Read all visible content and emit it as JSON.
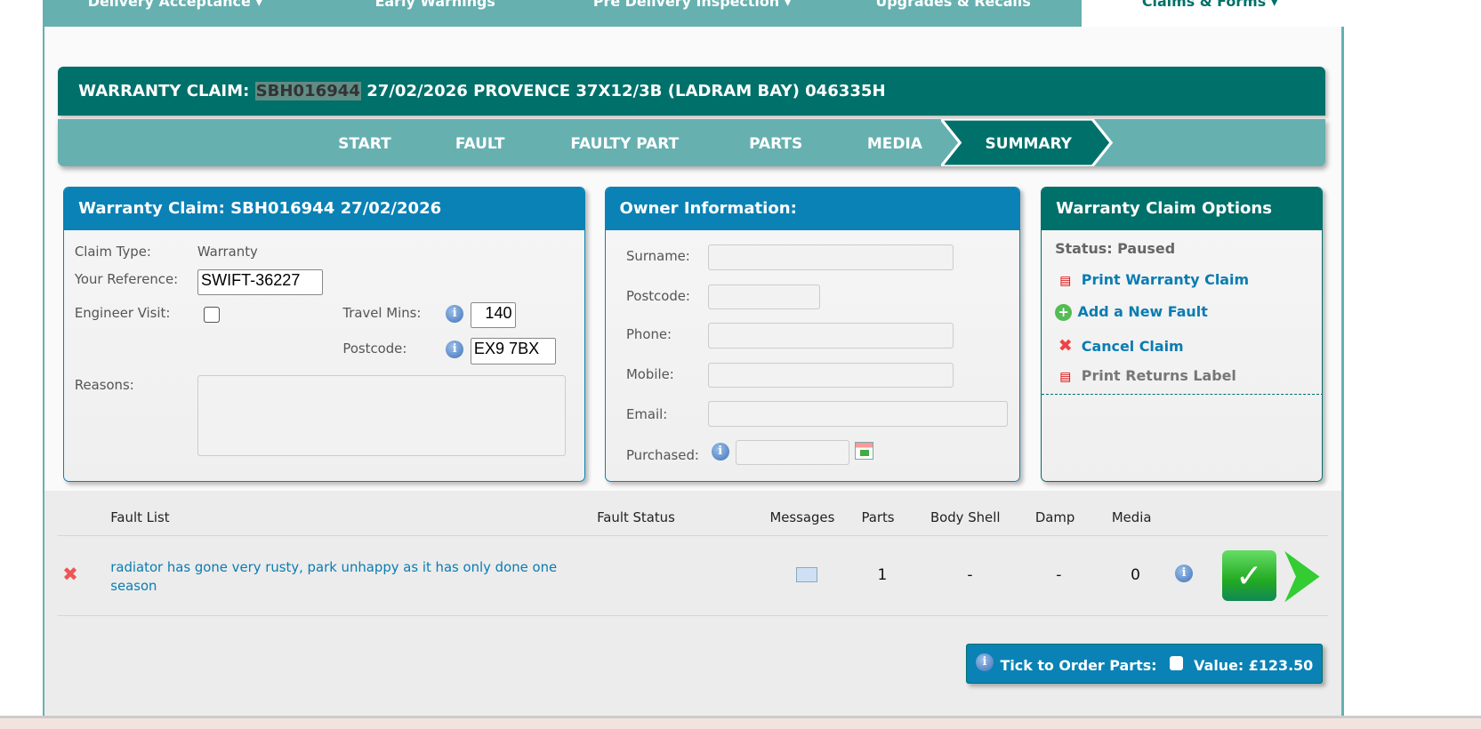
{
  "nav": {
    "items": [
      "Delivery Acceptance ▾",
      "Early Warnings",
      "Pre Delivery Inspection ▾",
      "Upgrades & Recalls"
    ],
    "active": "Claims & Forms ▾"
  },
  "header": {
    "prefix": "WARRANTY CLAIM:",
    "claim_id": "SBH016944",
    "rest": "27/02/2026 PROVENCE 37X12/3B (LADRAM BAY) 046335H"
  },
  "steps": [
    "START",
    "FAULT",
    "FAULTY PART",
    "PARTS",
    "MEDIA",
    "SUMMARY"
  ],
  "claim_panel": {
    "title": "Warranty Claim: SBH016944 27/02/2026",
    "claim_type_label": "Claim Type:",
    "claim_type": "Warranty",
    "reference_label": "Your Reference:",
    "reference": "SWIFT-36227",
    "engineer_label": "Engineer Visit:",
    "travel_label": "Travel Mins:",
    "travel": "140",
    "postcode_label": "Postcode:",
    "postcode": "EX9 7BX",
    "reasons_label": "Reasons:",
    "reasons": ""
  },
  "owner_panel": {
    "title": "Owner Information:",
    "surname": "Surname:",
    "postcode": "Postcode:",
    "phone": "Phone:",
    "mobile": "Mobile:",
    "email": "Email:",
    "purchased": "Purchased:"
  },
  "options_panel": {
    "title": "Warranty Claim Options",
    "status": "Status: Paused",
    "print": "Print Warranty Claim",
    "add": "Add a New Fault",
    "cancel": "Cancel Claim",
    "returns": "Print Returns Label"
  },
  "table": {
    "headers": [
      "Fault List",
      "Fault Status",
      "Messages",
      "Parts",
      "Body Shell",
      "Damp",
      "Media"
    ],
    "rows": [
      {
        "fault": "radiator has gone very rusty, park unhappy as it has only done one season",
        "status": "",
        "parts": "1",
        "body_shell": "-",
        "damp": "-",
        "media": "0"
      }
    ]
  },
  "order": {
    "label": "Tick to Order Parts:",
    "value": "Value: £123.50"
  }
}
